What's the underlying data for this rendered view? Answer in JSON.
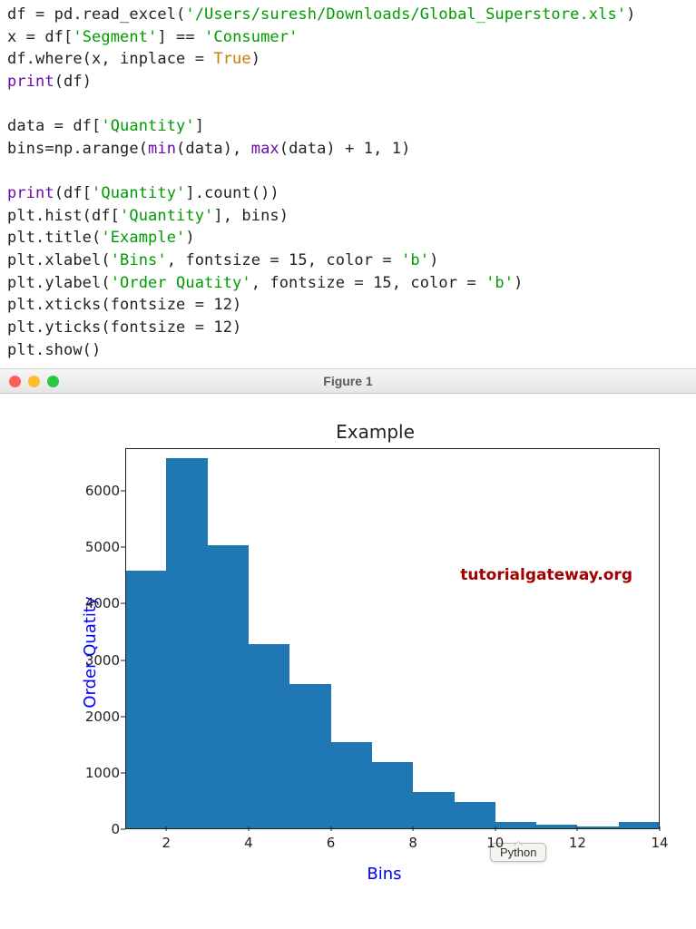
{
  "code": {
    "read_path": "'/Users/suresh/Downloads/Global_Superstore.xls'",
    "segment_col": "'Segment'",
    "segment_val": "'Consumer'",
    "true_kw": "True",
    "print_kw": "print",
    "quantity_col": "'Quantity'",
    "min_kw": "min",
    "max_kw": "max",
    "title_str": "'Example'",
    "bins_str": "'Bins'",
    "ylabel_str": "'Order Quatity'",
    "color_b": "'b'"
  },
  "window": {
    "title": "Figure 1"
  },
  "chart_data": {
    "type": "bar",
    "title": "Example",
    "xlabel": "Bins",
    "ylabel": "Order Quatity",
    "x_edges": [
      1,
      2,
      3,
      4,
      5,
      6,
      7,
      8,
      9,
      10,
      11,
      12,
      13,
      14
    ],
    "values": [
      4580,
      6580,
      5040,
      3280,
      2580,
      1540,
      1200,
      670,
      490,
      130,
      80,
      60,
      140
    ],
    "xticks": [
      2,
      4,
      6,
      8,
      10,
      12,
      14
    ],
    "yticks": [
      0,
      1000,
      2000,
      3000,
      4000,
      5000,
      6000
    ],
    "ylim": [
      0,
      6750
    ],
    "xlim": [
      1,
      14
    ],
    "annotation": "tutorialgateway.org"
  },
  "tooltip": "Python"
}
